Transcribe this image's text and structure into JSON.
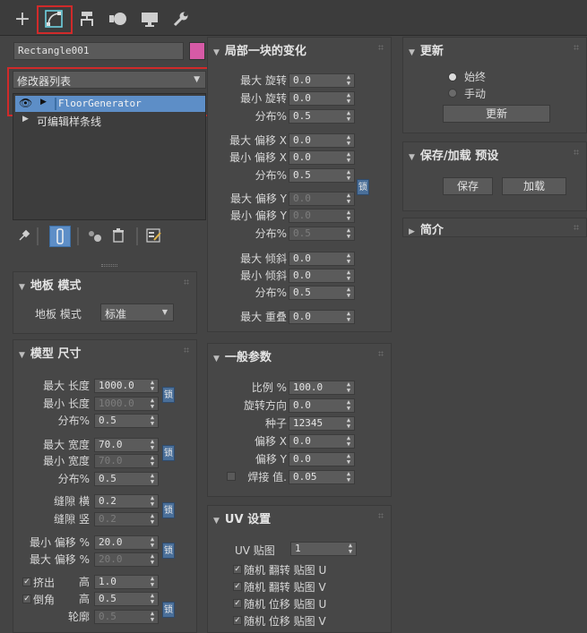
{
  "toolbar": {
    "tabs": [
      {
        "name": "create",
        "glyph": "+"
      },
      {
        "name": "modify"
      },
      {
        "name": "hierarchy"
      },
      {
        "name": "motion"
      },
      {
        "name": "display"
      },
      {
        "name": "utilities"
      }
    ]
  },
  "object": {
    "name": "Rectangle001",
    "color": "#d65aa6"
  },
  "modifier_list": {
    "label": "修改器列表"
  },
  "stack": [
    {
      "label": "FloorGenerator",
      "selected": true
    },
    {
      "label": "可编辑样条线",
      "selected": false
    }
  ],
  "floor_mode": {
    "title": "地板 模式",
    "label": "地板 模式",
    "value": "标准"
  },
  "model_size": {
    "title": "模型 尺寸",
    "rows": [
      {
        "label": "最大 长度",
        "value": "1000.0",
        "enabled": true
      },
      {
        "label": "最小 长度",
        "value": "1000.0",
        "enabled": false
      },
      {
        "label": "分布%",
        "value": "0.5",
        "enabled": true
      },
      {
        "label": "最大 宽度",
        "value": "70.0",
        "enabled": true
      },
      {
        "label": "最小 宽度",
        "value": "70.0",
        "enabled": false
      },
      {
        "label": "分布%",
        "value": "0.5",
        "enabled": true
      },
      {
        "label": "缝隙 横",
        "value": "0.2",
        "enabled": true
      },
      {
        "label": "缝隙 竖",
        "value": "0.2",
        "enabled": false
      },
      {
        "label": "最小 偏移 %",
        "value": "20.0",
        "enabled": true
      },
      {
        "label": "最大 偏移 %",
        "value": "20.0",
        "enabled": false
      },
      {
        "label": "高",
        "value": "1.0",
        "enabled": true
      },
      {
        "label": "高",
        "value": "0.5",
        "enabled": true
      },
      {
        "label": "轮廓",
        "value": "0.5",
        "enabled": false
      }
    ],
    "extrude_label": "挤出",
    "chamfer_label": "倒角",
    "lock_label": "锁"
  },
  "local_change": {
    "title": "局部一块的变化",
    "rows": [
      {
        "label": "最大 旋转",
        "value": "0.0",
        "enabled": true
      },
      {
        "label": "最小 旋转",
        "value": "0.0",
        "enabled": true
      },
      {
        "label": "分布%",
        "value": "0.5",
        "enabled": true
      },
      {
        "label": "最大 偏移 X",
        "value": "0.0",
        "enabled": true
      },
      {
        "label": "最小 偏移 X",
        "value": "0.0",
        "enabled": true
      },
      {
        "label": "分布%",
        "value": "0.5",
        "enabled": true
      },
      {
        "label": "最大 偏移 Y",
        "value": "0.0",
        "enabled": false
      },
      {
        "label": "最小 偏移 Y",
        "value": "0.0",
        "enabled": false
      },
      {
        "label": "分布%",
        "value": "0.5",
        "enabled": false
      },
      {
        "label": "最大 倾斜",
        "value": "0.0",
        "enabled": true
      },
      {
        "label": "最小 倾斜",
        "value": "0.0",
        "enabled": true
      },
      {
        "label": "分布%",
        "value": "0.5",
        "enabled": true
      },
      {
        "label": "最大 重叠",
        "value": "0.0",
        "enabled": true
      }
    ],
    "lock_label": "锁"
  },
  "general": {
    "title": "一般参数",
    "rows": [
      {
        "label": "比例 %",
        "value": "100.0",
        "enabled": true
      },
      {
        "label": "旋转方向",
        "value": "0.0",
        "enabled": true
      },
      {
        "label": "种子",
        "value": "12345",
        "enabled": true
      },
      {
        "label": "偏移 X",
        "value": "0.0",
        "enabled": true
      },
      {
        "label": "偏移 Y",
        "value": "0.0",
        "enabled": true
      },
      {
        "label": "焊接 值.",
        "value": "0.05",
        "enabled": true
      }
    ]
  },
  "uv": {
    "title": "UV 设置",
    "map_label": "UV 贴图",
    "map_value": "1",
    "checks": [
      {
        "label": "随机 翻转 贴图 U",
        "checked": true
      },
      {
        "label": "随机 翻转 贴图 V",
        "checked": true
      },
      {
        "label": "随机 位移 贴图 U",
        "checked": true
      },
      {
        "label": "随机 位移 贴图 V",
        "checked": true
      }
    ]
  },
  "update": {
    "title": "更新",
    "opt_always": "始终",
    "opt_manual": "手动",
    "button": "更新",
    "selected": "始终"
  },
  "presets": {
    "title": "保存/加载 预设",
    "save": "保存",
    "load": "加载"
  },
  "intro": {
    "title": "简介"
  }
}
